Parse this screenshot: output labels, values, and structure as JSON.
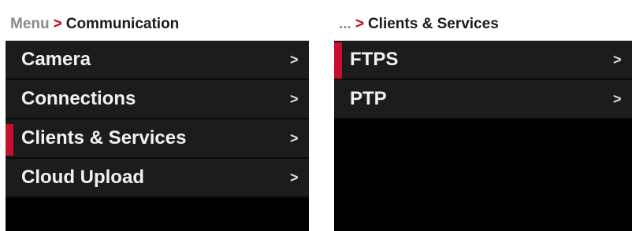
{
  "left_panel": {
    "breadcrumb": {
      "root": "Menu",
      "separator": ">",
      "current": "Communication"
    },
    "items": [
      {
        "label": "Camera",
        "chevron": ">",
        "selected": false
      },
      {
        "label": "Connections",
        "chevron": ">",
        "selected": false
      },
      {
        "label": "Clients & Services",
        "chevron": ">",
        "selected": true
      },
      {
        "label": "Cloud Upload",
        "chevron": ">",
        "selected": false
      }
    ]
  },
  "right_panel": {
    "breadcrumb": {
      "root": "...",
      "separator": ">",
      "current": "Clients & Services"
    },
    "items": [
      {
        "label": "FTPS",
        "chevron": ">",
        "selected": true
      },
      {
        "label": "PTP",
        "chevron": ">",
        "selected": false
      }
    ]
  },
  "colors": {
    "accent_red": "#c8102e",
    "item_bg": "#1c1c1c",
    "panel_bg": "#000000",
    "header_bg": "#ffffff"
  }
}
